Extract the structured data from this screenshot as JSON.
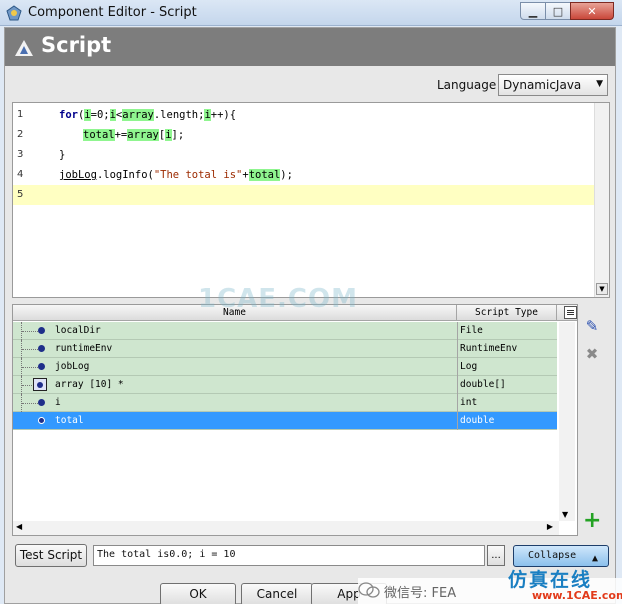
{
  "window": {
    "title": "Component Editor - Script",
    "heading": "Script"
  },
  "language": {
    "label": "Language",
    "selected": "DynamicJava"
  },
  "editor": {
    "line_numbers": [
      "1",
      "2",
      "3",
      "4",
      "5"
    ],
    "lines": [
      {
        "n": "1",
        "text": "for(i=0;i<array.length;i++){"
      },
      {
        "n": "2",
        "text": "total+=array[i];"
      },
      {
        "n": "3",
        "text": "}"
      },
      {
        "n": "4",
        "text": "jobLog.logInfo(\"The total is\"+total);"
      },
      {
        "n": "5",
        "text": ""
      }
    ],
    "current_line": "5"
  },
  "variables": {
    "columns": [
      "Name",
      "Script Type"
    ],
    "rows": [
      {
        "name": "localDir",
        "type": "File"
      },
      {
        "name": "runtimeEnv",
        "type": "RuntimeEnv"
      },
      {
        "name": "jobLog",
        "type": "Log"
      },
      {
        "name": "array [10] *",
        "type": "double[]"
      },
      {
        "name": "i",
        "type": "int"
      },
      {
        "name": "total",
        "type": "double"
      }
    ],
    "selected": "total"
  },
  "bottom": {
    "test_script": "Test Script",
    "output": "The total is0.0; i = 10",
    "ellipsis": "...",
    "collapse": "Collapse"
  },
  "buttons": {
    "ok": "OK",
    "cancel": "Cancel",
    "apply": "App"
  },
  "watermarks": {
    "center": "1CAE.COM",
    "wechat": "微信号: FEA",
    "brand": "仿真在线",
    "url": "www.1CAE.com"
  },
  "colors": {
    "header": "#7d7d7d",
    "highlight_var": "#8ff58f",
    "current_line": "#ffffc2",
    "row_bg": "#cfe6cf",
    "selected_row": "#3399ff"
  }
}
